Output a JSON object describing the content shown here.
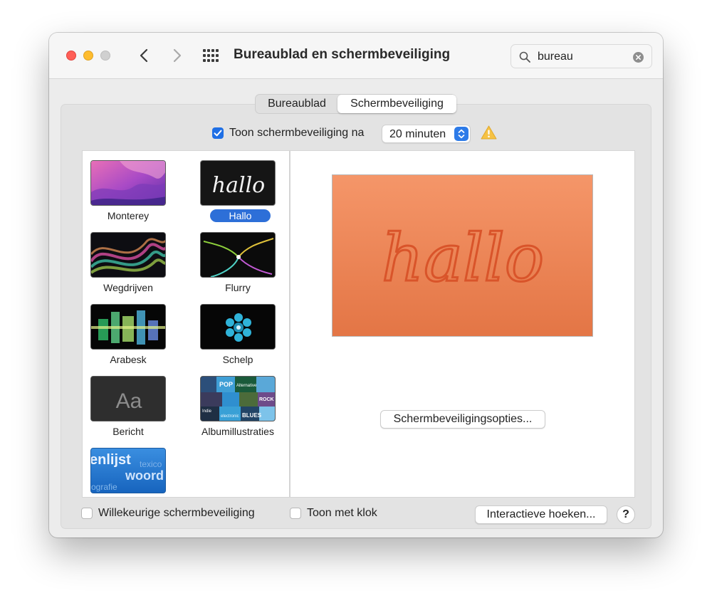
{
  "window": {
    "title": "Bureaublad en schermbeveiliging",
    "search": {
      "value": "bureau",
      "placeholder": ""
    }
  },
  "tabs": [
    {
      "label": "Bureaublad",
      "selected": false
    },
    {
      "label": "Schermbeveiliging",
      "selected": true
    }
  ],
  "show_after": {
    "checked": true,
    "label": "Toon schermbeveiliging na",
    "selected_value": "20 minuten"
  },
  "screensavers": [
    {
      "name": "Monterey",
      "selected": false
    },
    {
      "name": "Hallo",
      "selected": true
    },
    {
      "name": "Wegdrijven",
      "selected": false
    },
    {
      "name": "Flurry",
      "selected": false
    },
    {
      "name": "Arabesk",
      "selected": false
    },
    {
      "name": "Schelp",
      "selected": false
    },
    {
      "name": "Bericht",
      "selected": false
    },
    {
      "name": "Albumillustraties",
      "selected": false
    },
    {
      "name": "",
      "selected": false
    }
  ],
  "thumb_text": {
    "hallo": "hallo",
    "bericht": "Aa",
    "album": [
      "POP",
      "BLUES",
      "electronic",
      "Alternative",
      "Indie",
      "ROCK"
    ],
    "wordlist": [
      "enlijst",
      "woord",
      "texico",
      "ografie"
    ]
  },
  "preview": {
    "text": "hallo"
  },
  "options_button": "Schermbeveiligingsopties...",
  "bottom": {
    "random_label": "Willekeurige schermbeveiliging",
    "random_checked": false,
    "clock_label": "Toon met klok",
    "clock_checked": false,
    "corners_button": "Interactieve hoeken...",
    "help": "?"
  },
  "colors": {
    "accent": "#2d6fd8",
    "preview_top": "#f59669",
    "preview_bottom": "#e37545",
    "hallo_stroke": "#d9542a",
    "warning": "#f6c244"
  },
  "icons": [
    "close-light",
    "minimize-light",
    "zoom-light",
    "chevron-left-icon",
    "chevron-right-icon",
    "grid-icon",
    "search-icon",
    "clear-icon",
    "chevron-updown-icon",
    "warning-icon",
    "question-icon"
  ]
}
